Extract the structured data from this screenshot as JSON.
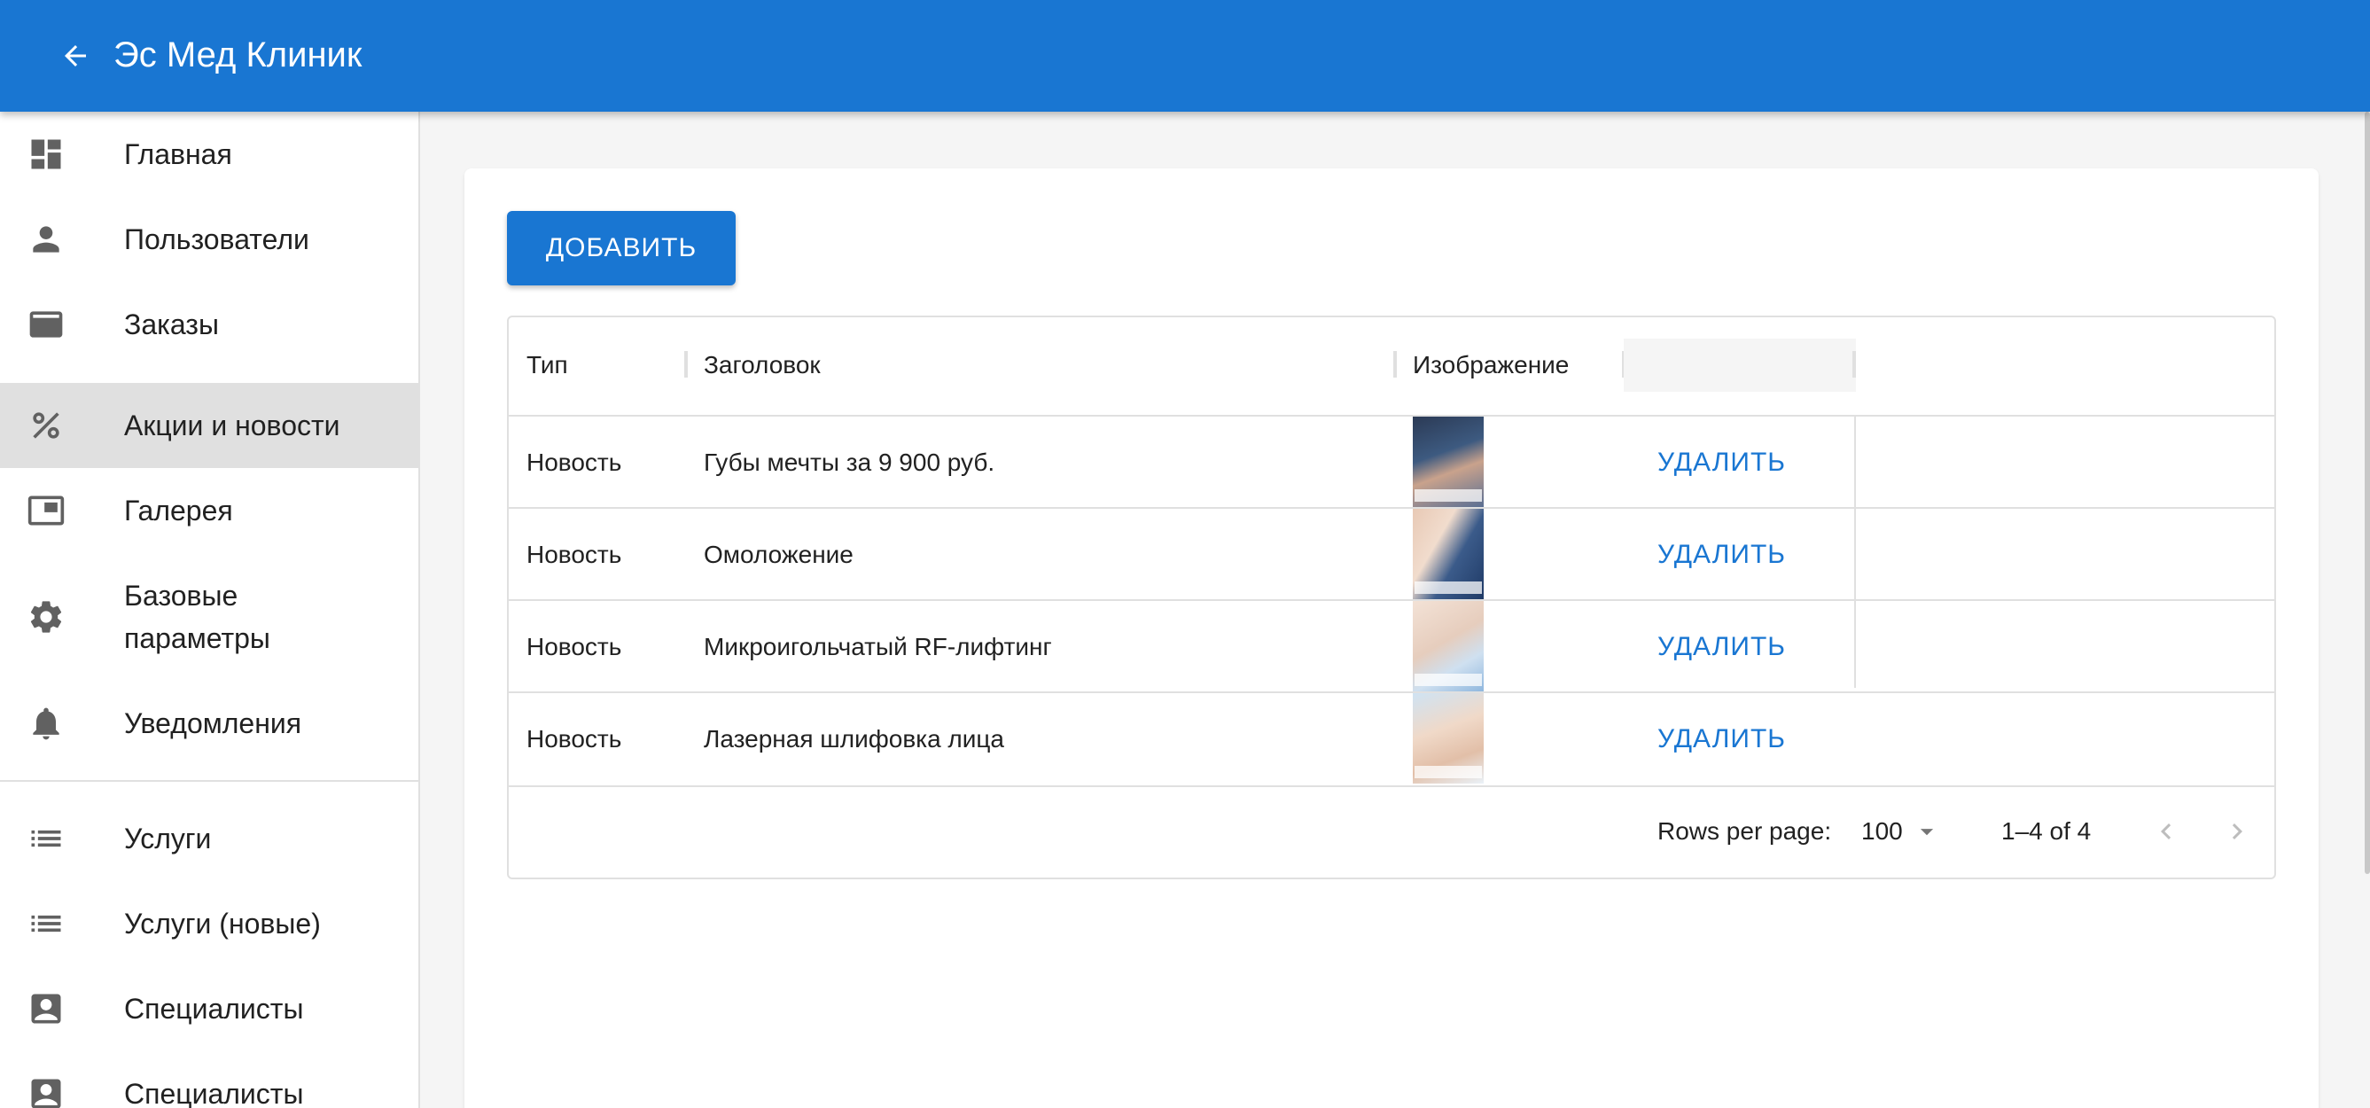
{
  "appbar": {
    "title": "Эс Мед Клиник",
    "back_icon": "arrow-left-icon",
    "color": "#1976d2"
  },
  "sidebar": {
    "items": [
      {
        "label": "Главная",
        "icon": "dashboard-icon"
      },
      {
        "label": "Пользователи",
        "icon": "person-icon"
      },
      {
        "label": "Заказы",
        "icon": "card-icon"
      },
      {
        "label": "Акции и новости",
        "icon": "percent-icon",
        "active": true
      },
      {
        "label": "Галерея",
        "icon": "picture-in-picture-icon"
      },
      {
        "label": "Базовые параметры",
        "label_line1": "Базовые",
        "label_line2": "параметры",
        "icon": "gear-icon"
      },
      {
        "label": "Уведомления",
        "icon": "bell-icon"
      },
      {
        "label": "Услуги",
        "icon": "list-icon"
      },
      {
        "label": "Услуги (новые)",
        "icon": "list-icon"
      },
      {
        "label": "Специалисты",
        "icon": "contact-icon"
      },
      {
        "label": "Специалисты",
        "icon": "contact-icon"
      }
    ]
  },
  "main": {
    "add_button": "ДОБАВИТЬ",
    "table": {
      "columns": [
        "Тип",
        "Заголовок",
        "Изображение"
      ],
      "rows": [
        {
          "type": "Новость",
          "title": "Губы мечты за 9 900 руб.",
          "action": "УДАЛИТЬ"
        },
        {
          "type": "Новость",
          "title": "Омоложение",
          "action": "УДАЛИТЬ"
        },
        {
          "type": "Новость",
          "title": "Микроигольчатый RF-лифтинг",
          "action": "УДАЛИТЬ"
        },
        {
          "type": "Новость",
          "title": "Лазерная шлифовка лица",
          "action": "УДАЛИТЬ"
        }
      ]
    },
    "pagination": {
      "rows_per_page_label": "Rows per page:",
      "rows_per_page": "100",
      "range": "1–4 of 4"
    }
  }
}
